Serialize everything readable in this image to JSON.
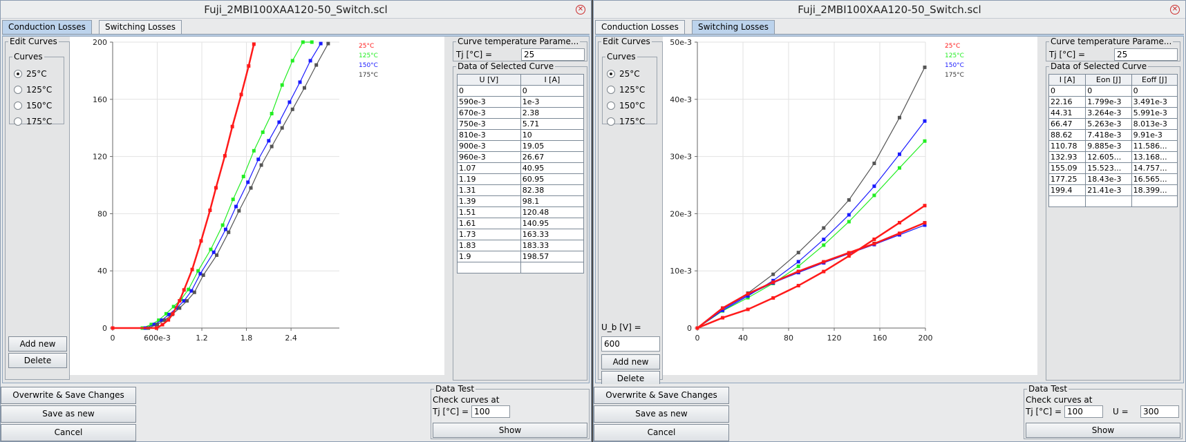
{
  "windows": [
    {
      "title": "Fuji_2MBI100XAA120-50_Switch.scl",
      "tabs": [
        "Conduction Losses",
        "Switching Losses"
      ],
      "edit_curves": {
        "legend": "Edit Curves",
        "curves_legend": "Curves",
        "items": [
          "25°C",
          "125°C",
          "150°C",
          "175°C"
        ],
        "selected": "25°C"
      },
      "add_new": "Add new",
      "delete": "Delete",
      "temp_param": {
        "legend": "Curve temperature Parame...",
        "label": "Tj [°C] =",
        "value": "25"
      },
      "selected_curve": {
        "legend": "Data of Selected Curve",
        "headers": [
          "U [V]",
          "I [A]"
        ],
        "rows": [
          [
            "0",
            "0"
          ],
          [
            "590e-3",
            "1e-3"
          ],
          [
            "670e-3",
            "2.38"
          ],
          [
            "750e-3",
            "5.71"
          ],
          [
            "810e-3",
            "10"
          ],
          [
            "900e-3",
            "19.05"
          ],
          [
            "960e-3",
            "26.67"
          ],
          [
            "1.07",
            "40.95"
          ],
          [
            "1.19",
            "60.95"
          ],
          [
            "1.31",
            "82.38"
          ],
          [
            "1.39",
            "98.1"
          ],
          [
            "1.51",
            "120.48"
          ],
          [
            "1.61",
            "140.95"
          ],
          [
            "1.73",
            "163.33"
          ],
          [
            "1.83",
            "183.33"
          ],
          [
            "1.9",
            "198.57"
          ],
          [
            "",
            ""
          ]
        ]
      },
      "buttons": {
        "overwrite": "Overwrite & Save Changes",
        "save_new": "Save as new",
        "cancel": "Cancel"
      },
      "data_test": {
        "legend": "Data Test",
        "check_label": "Check curves at",
        "tj_label": "Tj [°C] =",
        "tj_value": "100",
        "show": "Show"
      }
    },
    {
      "title": "Fuji_2MBI100XAA120-50_Switch.scl",
      "tabs": [
        "Conduction Losses",
        "Switching Losses"
      ],
      "edit_curves": {
        "legend": "Edit Curves",
        "curves_legend": "Curves",
        "items": [
          "25°C",
          "125°C",
          "150°C",
          "175°C"
        ],
        "selected": "25°C"
      },
      "ub_label": "U_b [V] =",
      "ub_value": "600",
      "add_new": "Add new",
      "delete": "Delete",
      "temp_param": {
        "legend": "Curve temperature Parame...",
        "label": "Tj [°C] =",
        "value": "25"
      },
      "selected_curve": {
        "legend": "Data of Selected Curve",
        "headers": [
          "I [A]",
          "Eon [J]",
          "Eoff [J]"
        ],
        "rows": [
          [
            "0",
            "0",
            "0"
          ],
          [
            "22.16",
            "1.799e-3",
            "3.491e-3"
          ],
          [
            "44.31",
            "3.264e-3",
            "5.991e-3"
          ],
          [
            "66.47",
            "5.263e-3",
            "8.013e-3"
          ],
          [
            "88.62",
            "7.418e-3",
            "9.91e-3"
          ],
          [
            "110.78",
            "9.885e-3",
            "11.586..."
          ],
          [
            "132.93",
            "12.605...",
            "13.168..."
          ],
          [
            "155.09",
            "15.523...",
            "14.757..."
          ],
          [
            "177.25",
            "18.43e-3",
            "16.565..."
          ],
          [
            "199.4",
            "21.41e-3",
            "18.399..."
          ],
          [
            "",
            "",
            ""
          ]
        ]
      },
      "buttons": {
        "overwrite": "Overwrite & Save Changes",
        "save_new": "Save as new",
        "cancel": "Cancel"
      },
      "data_test": {
        "legend": "Data Test",
        "check_label": "Check curves at",
        "tj_label": "Tj [°C] =",
        "tj_value": "100",
        "u_label": "U =",
        "u_value": "300",
        "show": "Show"
      }
    }
  ],
  "chart_data": [
    {
      "type": "line",
      "x_ticks": [
        "0",
        "600e-3",
        "1.2",
        "1.8",
        "2.4"
      ],
      "y_ticks": [
        "0",
        "40",
        "80",
        "120",
        "160",
        "200"
      ],
      "xlim": [
        0,
        3.05
      ],
      "ylim": [
        0,
        200
      ],
      "legend": [
        "25°C",
        "125°C",
        "150°C",
        "175°C"
      ],
      "series": [
        {
          "name": "25°C",
          "color": "#ff1a1a",
          "x": [
            0,
            0.59,
            0.67,
            0.75,
            0.81,
            0.9,
            0.96,
            1.07,
            1.19,
            1.31,
            1.39,
            1.51,
            1.61,
            1.73,
            1.83,
            1.9
          ],
          "y": [
            0,
            0.001,
            2.38,
            5.71,
            10,
            19.05,
            26.67,
            40.95,
            60.95,
            82.38,
            98.1,
            120.48,
            140.95,
            163.33,
            183.33,
            198.57
          ]
        },
        {
          "name": "125°C",
          "color": "#22ee22",
          "x": [
            0,
            0.4,
            0.52,
            0.62,
            0.72,
            0.82,
            0.92,
            1.02,
            1.15,
            1.32,
            1.48,
            1.62,
            1.76,
            1.9,
            2.02,
            2.14,
            2.28,
            2.42,
            2.56,
            2.68
          ],
          "y": [
            0,
            0.001,
            2.5,
            5.5,
            10,
            15,
            20,
            27,
            40,
            55,
            72,
            90,
            106,
            124,
            137,
            150,
            170,
            187,
            200,
            200
          ]
        },
        {
          "name": "150°C",
          "color": "#1a1aff",
          "x": [
            0,
            0.44,
            0.56,
            0.66,
            0.76,
            0.86,
            0.96,
            1.06,
            1.18,
            1.36,
            1.52,
            1.66,
            1.82,
            1.96,
            2.1,
            2.24,
            2.38,
            2.52,
            2.66,
            2.8
          ],
          "y": [
            0,
            0.001,
            2.5,
            5.5,
            9.5,
            14,
            19,
            26,
            38,
            53,
            69,
            85,
            102,
            118,
            131,
            144,
            158,
            172,
            187,
            199
          ]
        },
        {
          "name": "175°C",
          "color": "#555555",
          "x": [
            0,
            0.48,
            0.6,
            0.7,
            0.8,
            0.9,
            1.0,
            1.1,
            1.22,
            1.4,
            1.56,
            1.7,
            1.86,
            2.0,
            2.14,
            2.28,
            2.42,
            2.58,
            2.74,
            2.9
          ],
          "y": [
            0,
            0.001,
            2.5,
            5.5,
            9.5,
            14,
            19,
            25,
            37,
            51,
            67,
            82,
            98,
            114,
            127,
            140,
            153,
            168,
            184,
            199
          ]
        }
      ]
    },
    {
      "type": "line",
      "x_ticks": [
        "0",
        "40",
        "80",
        "120",
        "160",
        "200"
      ],
      "y_ticks": [
        "0",
        "10e-3",
        "20e-3",
        "30e-3",
        "40e-3",
        "50e-3"
      ],
      "xlim": [
        0,
        200
      ],
      "ylim": [
        0,
        0.05
      ],
      "legend": [
        "25°C",
        "125°C",
        "150°C",
        "175°C"
      ],
      "series": [
        {
          "name": "25°C Eon",
          "color": "#ff1a1a",
          "x": [
            0,
            22.16,
            44.31,
            66.47,
            88.62,
            110.78,
            132.93,
            155.09,
            177.25,
            199.4
          ],
          "y": [
            0,
            0.001799,
            0.003264,
            0.005263,
            0.007418,
            0.009885,
            0.012605,
            0.015523,
            0.01843,
            0.02141
          ]
        },
        {
          "name": "25°C Eoff",
          "color": "#ff1a1a",
          "x": [
            0,
            22.16,
            44.31,
            66.47,
            88.62,
            110.78,
            132.93,
            155.09,
            177.25,
            199.4
          ],
          "y": [
            0,
            0.003491,
            0.005991,
            0.008013,
            0.00991,
            0.011586,
            0.013168,
            0.014757,
            0.016565,
            0.018399
          ]
        },
        {
          "name": "125°C Eon",
          "color": "#22ee22",
          "x": [
            0,
            22.16,
            44.31,
            66.47,
            88.62,
            110.78,
            132.93,
            155.09,
            177.25,
            199.4
          ],
          "y": [
            0,
            0.003,
            0.0053,
            0.0078,
            0.0108,
            0.0145,
            0.0186,
            0.0232,
            0.028,
            0.0327
          ]
        },
        {
          "name": "150°C Eon",
          "color": "#1a1aff",
          "x": [
            0,
            22.16,
            44.31,
            66.47,
            88.62,
            110.78,
            132.93,
            155.09,
            177.25,
            199.4
          ],
          "y": [
            0,
            0.0031,
            0.0056,
            0.0083,
            0.0116,
            0.0155,
            0.0198,
            0.0248,
            0.0304,
            0.0362
          ]
        },
        {
          "name": "175°C Eon",
          "color": "#555555",
          "x": [
            0,
            22.16,
            44.31,
            66.47,
            88.62,
            110.78,
            132.93,
            155.09,
            177.25,
            199.4
          ],
          "y": [
            0,
            0.0034,
            0.0061,
            0.0094,
            0.0132,
            0.0175,
            0.0224,
            0.0288,
            0.0368,
            0.0456
          ]
        },
        {
          "name": "175°C Eoff",
          "color": "#555555",
          "x": [
            0,
            22.16,
            44.31,
            66.47,
            88.62,
            110.78,
            132.93,
            155.09,
            177.25,
            199.4
          ],
          "y": [
            0,
            0.0035,
            0.006,
            0.0079,
            0.0098,
            0.0115,
            0.0131,
            0.0148,
            0.0165,
            0.0184
          ]
        },
        {
          "name": "150°C Eoff",
          "color": "#1a1aff",
          "x": [
            0,
            22.16,
            44.31,
            66.47,
            88.62,
            110.78,
            132.93,
            155.09,
            177.25,
            199.4
          ],
          "y": [
            0,
            0.0033,
            0.0058,
            0.0079,
            0.0097,
            0.0114,
            0.013,
            0.0146,
            0.0163,
            0.018
          ]
        }
      ]
    }
  ]
}
